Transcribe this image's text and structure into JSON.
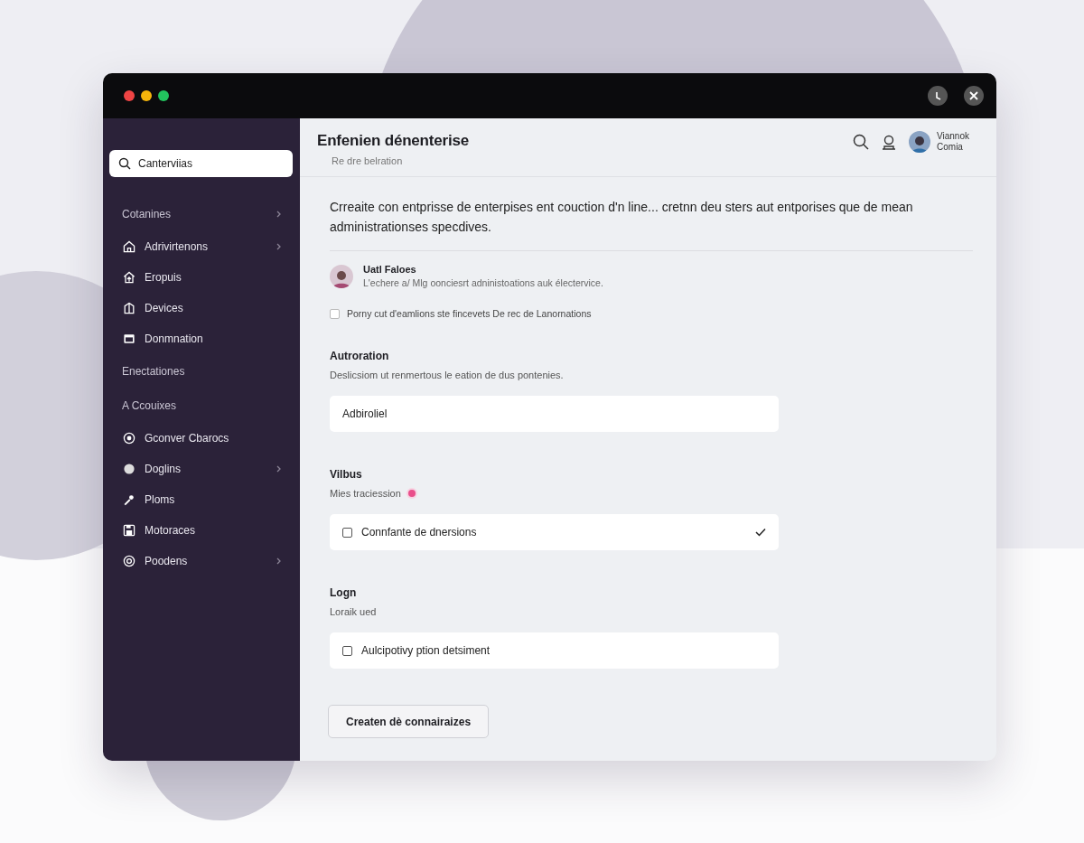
{
  "window": {
    "controls": [
      {
        "color": "#ef4444"
      },
      {
        "color": "#f5b50b"
      },
      {
        "color": "#22c55e"
      }
    ]
  },
  "sidebar": {
    "search": {
      "value": "Canterviias"
    },
    "items": [
      {
        "kind": "group",
        "label": "Cotanines",
        "chevron": true
      },
      {
        "kind": "link",
        "label": "Adrivirtenons",
        "chevron": true
      },
      {
        "kind": "link",
        "label": "Eropuis",
        "chevron": false
      },
      {
        "kind": "link",
        "label": "Devices",
        "chevron": false
      },
      {
        "kind": "link",
        "label": "Donmnation",
        "chevron": false
      },
      {
        "kind": "group",
        "label": "Enectationes",
        "chevron": false
      },
      {
        "kind": "group",
        "label": "A Ccouixes",
        "chevron": false
      },
      {
        "kind": "link",
        "label": "Gconver Cbarocs",
        "chevron": false
      },
      {
        "kind": "link",
        "label": "Doglins",
        "chevron": true
      },
      {
        "kind": "link",
        "label": "Ploms",
        "chevron": false
      },
      {
        "kind": "link",
        "label": "Motoraces",
        "chevron": false
      },
      {
        "kind": "link",
        "label": "Poodens",
        "chevron": true
      }
    ]
  },
  "header": {
    "title": "Enfenien dénenterise",
    "subtitle": "Re dre belration",
    "user": {
      "first": "Viannok",
      "last": "Comia"
    }
  },
  "intro": "Crreaite con entprisse de enterpises ent couction d'n line... cretnn deu sters aut entporises que de mean administrationses specdives.",
  "person": {
    "name": "Uatl Faloes",
    "description": "L'echere a/ Mlg oonciesrt adninistoations auk électervice."
  },
  "consent": {
    "label": "Porny cut d'eamlions ste fincevets De rec de Lanornations",
    "checked": false
  },
  "sections": [
    {
      "title": "Autroration",
      "description": "Deslicsiom ut renmertous le eation de dus pontenies.",
      "required": false,
      "field": {
        "kind": "text",
        "value": "Adbiroliel"
      }
    },
    {
      "title": "Vilbus",
      "description": "Mies traciession",
      "required": true,
      "field": {
        "kind": "select",
        "label": "Connfante de dnersions",
        "checked": false
      }
    },
    {
      "title": "Logn",
      "description": "Loraik ued",
      "required": false,
      "field": {
        "kind": "checkbox",
        "label": "Aulcipotivy ption detsiment",
        "checked": false
      }
    }
  ],
  "button": "Createn dè connairaizes"
}
